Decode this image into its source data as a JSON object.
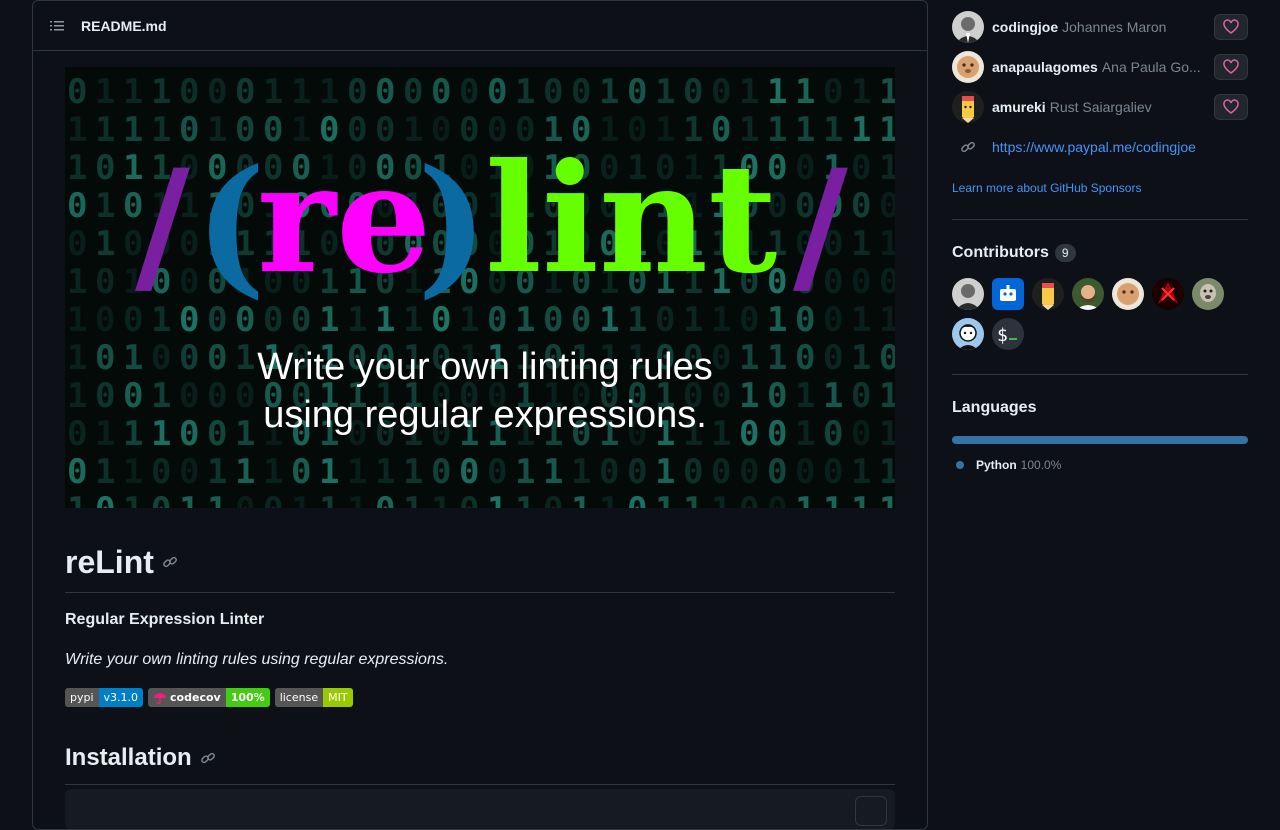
{
  "readme": {
    "file_name": "README.md",
    "banner": {
      "logo_parts": [
        "/",
        "(",
        "re",
        ")",
        "lint",
        "/"
      ],
      "tagline_line1": "Write your own linting rules",
      "tagline_line2": "using regular expressions."
    },
    "title": "reLint",
    "subtitle": "Regular Expression Linter",
    "tagline": "Write your own linting rules using regular expressions.",
    "badges": [
      {
        "label": "pypi",
        "value": "v3.1.0",
        "color": "#007ec6"
      },
      {
        "label": "codecov",
        "value": "100%",
        "color": "#44cc11"
      },
      {
        "label": "license",
        "value": "MIT",
        "color": "#97ca00"
      }
    ],
    "installation_heading": "Installation"
  },
  "sidebar": {
    "sponsors": [
      {
        "login": "codingjoe",
        "name": "Johannes Maron"
      },
      {
        "login": "anapaulagomes",
        "name": "Ana Paula Go..."
      },
      {
        "login": "amureki",
        "name": "Rust Saiargaliev"
      }
    ],
    "sponsor_link": "https://www.paypal.me/codingjoe",
    "learn_more": "Learn more about GitHub Sponsors",
    "contributors_title": "Contributors",
    "contributors_count": "9",
    "languages_title": "Languages",
    "languages": [
      {
        "name": "Python",
        "percent": "100.0%",
        "color": "#3572a5"
      }
    ]
  },
  "colors": {
    "background": "#0d1117",
    "border": "#30363d",
    "link": "#4493f8",
    "heart": "#db61a2",
    "logo_purple": "#7a1fa2",
    "logo_blue": "#0b6aa2",
    "logo_magenta": "#ff00ff",
    "logo_green": "#66ff00"
  }
}
